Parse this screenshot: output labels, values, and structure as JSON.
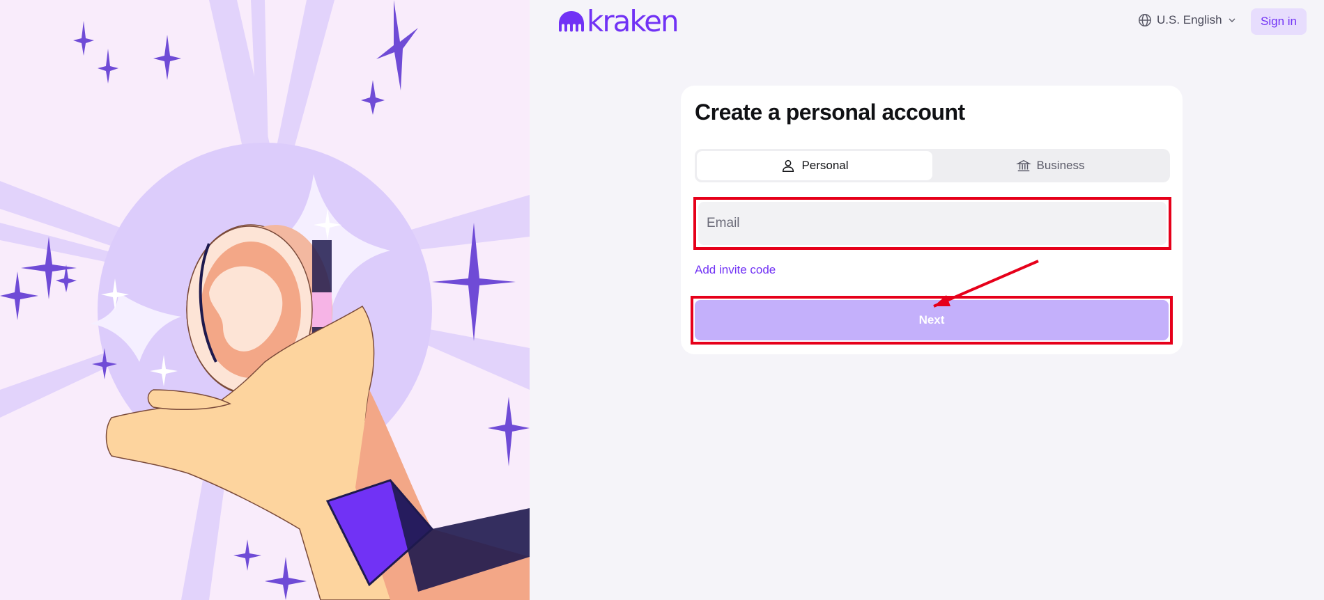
{
  "header": {
    "brand": "kraken",
    "language": "U.S. English",
    "signin_label": "Sign in"
  },
  "signup": {
    "title": "Create a personal account",
    "tabs": [
      {
        "label": "Personal",
        "icon": "person-icon",
        "selected": true
      },
      {
        "label": "Business",
        "icon": "bank-icon",
        "selected": false
      }
    ],
    "email_placeholder": "Email",
    "email_value": "",
    "invite_link": "Add invite code",
    "next_label": "Next"
  },
  "colors": {
    "brand": "#7132f5",
    "button_disabled": "#c4b0fb",
    "highlight": "#e6001a",
    "hero_bg": "#f9ecfb"
  }
}
